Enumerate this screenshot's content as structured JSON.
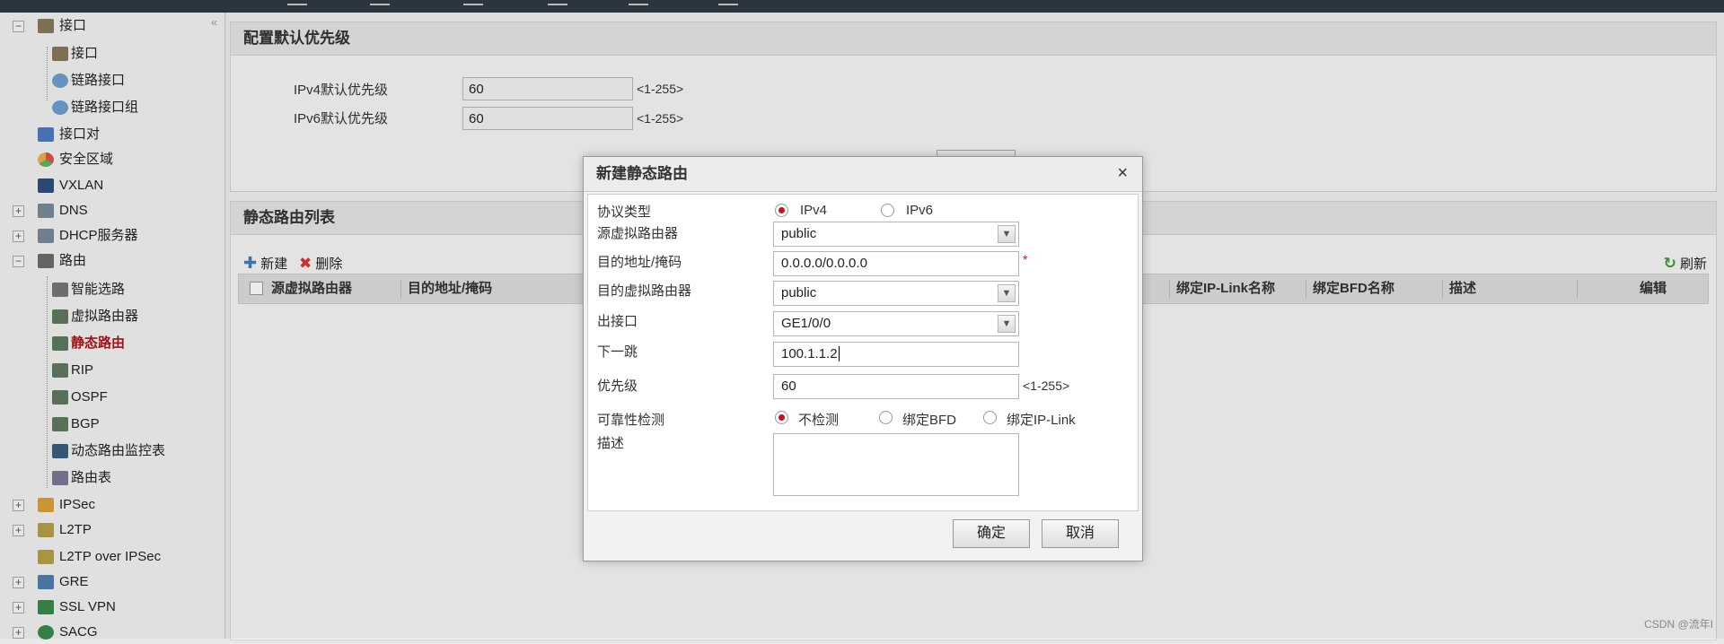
{
  "sidebar": {
    "items": [
      {
        "label": "接口",
        "icon": "interface-icon",
        "level": 0,
        "toggle": "minus"
      },
      {
        "label": "接口",
        "icon": "interface-icon",
        "level": 1
      },
      {
        "label": "链路接口",
        "icon": "link-interface-icon",
        "level": 1
      },
      {
        "label": "链路接口组",
        "icon": "link-group-icon",
        "level": 1
      },
      {
        "label": "接口对",
        "icon": "interface-pair-icon",
        "level": 0
      },
      {
        "label": "安全区域",
        "icon": "security-zone-icon",
        "level": 0
      },
      {
        "label": "VXLAN",
        "icon": "vxlan-icon",
        "level": 0
      },
      {
        "label": "DNS",
        "icon": "dns-icon",
        "level": 0,
        "toggle": "plus"
      },
      {
        "label": "DHCP服务器",
        "icon": "dhcp-icon",
        "level": 0,
        "toggle": "plus"
      },
      {
        "label": "路由",
        "icon": "router-icon",
        "level": 0,
        "toggle": "minus"
      },
      {
        "label": "智能选路",
        "icon": "smart-route-icon",
        "level": 1
      },
      {
        "label": "虚拟路由器",
        "icon": "virtual-router-icon",
        "level": 1
      },
      {
        "label": "静态路由",
        "icon": "static-route-icon",
        "level": 1,
        "active": true
      },
      {
        "label": "RIP",
        "icon": "rip-icon",
        "level": 1
      },
      {
        "label": "OSPF",
        "icon": "ospf-icon",
        "level": 1
      },
      {
        "label": "BGP",
        "icon": "bgp-icon",
        "level": 1
      },
      {
        "label": "动态路由监控表",
        "icon": "monitor-icon",
        "level": 1
      },
      {
        "label": "路由表",
        "icon": "route-table-icon",
        "level": 1
      },
      {
        "label": "IPSec",
        "icon": "ipsec-icon",
        "level": 0,
        "toggle": "plus"
      },
      {
        "label": "L2TP",
        "icon": "l2tp-icon",
        "level": 0,
        "toggle": "plus"
      },
      {
        "label": "L2TP over IPSec",
        "icon": "l2tp-ipsec-icon",
        "level": 0
      },
      {
        "label": "GRE",
        "icon": "gre-icon",
        "level": 0,
        "toggle": "plus"
      },
      {
        "label": "SSL VPN",
        "icon": "ssl-vpn-icon",
        "level": 0,
        "toggle": "plus"
      },
      {
        "label": "SACG",
        "icon": "sacg-icon",
        "level": 0,
        "toggle": "plus"
      }
    ]
  },
  "priority_panel": {
    "title": "配置默认优先级",
    "ipv4_label": "IPv4默认优先级",
    "ipv4_value": "60",
    "ipv6_label": "IPv6默认优先级",
    "ipv6_value": "60",
    "range_hint": "<1-255>"
  },
  "route_list": {
    "title": "静态路由列表",
    "new_label": "新建",
    "delete_label": "删除",
    "refresh_label": "刷新",
    "columns": [
      "源虚拟路由器",
      "目的地址/掩码",
      "绑定IP-Link名称",
      "绑定BFD名称",
      "描述",
      "编辑"
    ]
  },
  "dialog": {
    "title": "新建静态路由",
    "close": "×",
    "protocol_label": "协议类型",
    "protocol_options": [
      "IPv4",
      "IPv6"
    ],
    "src_vr_label": "源虚拟路由器",
    "src_vr_value": "public",
    "dest_label": "目的地址/掩码",
    "dest_value": "0.0.0.0/0.0.0.0",
    "required_mark": "*",
    "dest_vr_label": "目的虚拟路由器",
    "dest_vr_value": "public",
    "out_if_label": "出接口",
    "out_if_value": "GE1/0/0",
    "next_hop_label": "下一跳",
    "next_hop_value": "100.1.1.2",
    "priority_label": "优先级",
    "priority_value": "60",
    "priority_hint": "<1-255>",
    "reliability_label": "可靠性检测",
    "reliability_options": [
      "不检测",
      "绑定BFD",
      "绑定IP-Link"
    ],
    "desc_label": "描述",
    "desc_value": "",
    "ok_label": "确定",
    "cancel_label": "取消"
  },
  "watermark": "CSDN @流年I",
  "colors": {
    "accent_red": "#c0141c",
    "topbar": "#2f3a46"
  }
}
